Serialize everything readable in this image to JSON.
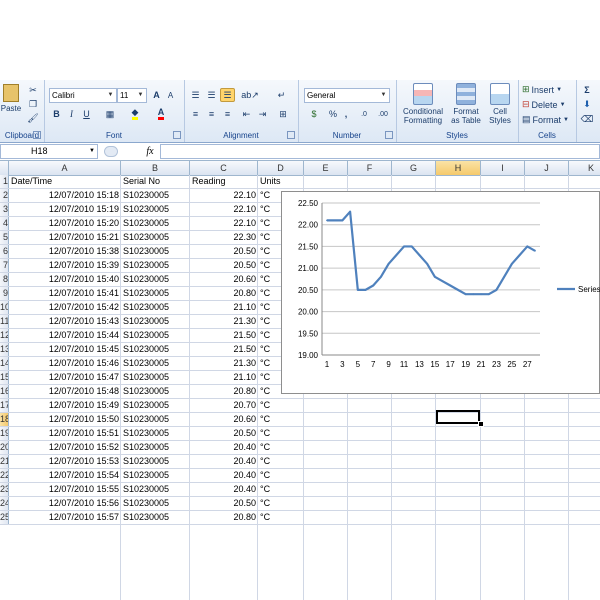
{
  "ribbon": {
    "clipboard": {
      "label": "Clipboard",
      "paste_label": "Paste"
    },
    "font": {
      "label": "Font",
      "name": "Calibri",
      "size": "11",
      "grow": "A",
      "shrink": "A",
      "bold": "B",
      "italic": "I",
      "underline": "U"
    },
    "alignment": {
      "label": "Alignment"
    },
    "number": {
      "label": "Number",
      "format": "General",
      "currency": "$",
      "percent": "%",
      "comma": ",",
      "inc_decimal": ".0",
      "dec_decimal": ".00"
    },
    "styles": {
      "label": "Styles",
      "conditional": [
        "Conditional",
        "Formatting"
      ],
      "format_table": [
        "Format",
        "as Table"
      ],
      "cell_styles": [
        "Cell",
        "Styles"
      ]
    },
    "cells": {
      "label": "Cells",
      "insert": "Insert",
      "delete": "Delete",
      "format": "Format"
    },
    "editing": {
      "sigma": "Σ"
    }
  },
  "formula_bar": {
    "name_box": "H18",
    "fx": "fx",
    "formula": ""
  },
  "columns": [
    "A",
    "B",
    "C",
    "D",
    "E",
    "F",
    "G",
    "H",
    "I",
    "J",
    "K"
  ],
  "active_column": "H",
  "active_row": "18",
  "sheet": {
    "header": {
      "row": "1",
      "date": "Date/Time",
      "serial": "Serial No",
      "reading": "Reading",
      "units": "Units"
    },
    "rows": [
      {
        "row": "2",
        "date": "12/07/2010 15:18",
        "serial": "S10230005",
        "reading": "22.10",
        "units": "°C"
      },
      {
        "row": "3",
        "date": "12/07/2010 15:19",
        "serial": "S10230005",
        "reading": "22.10",
        "units": "°C"
      },
      {
        "row": "4",
        "date": "12/07/2010 15:20",
        "serial": "S10230005",
        "reading": "22.10",
        "units": "°C"
      },
      {
        "row": "5",
        "date": "12/07/2010 15:21",
        "serial": "S10230005",
        "reading": "22.30",
        "units": "°C"
      },
      {
        "row": "6",
        "date": "12/07/2010 15:38",
        "serial": "S10230005",
        "reading": "20.50",
        "units": "°C"
      },
      {
        "row": "7",
        "date": "12/07/2010 15:39",
        "serial": "S10230005",
        "reading": "20.50",
        "units": "°C"
      },
      {
        "row": "8",
        "date": "12/07/2010 15:40",
        "serial": "S10230005",
        "reading": "20.60",
        "units": "°C"
      },
      {
        "row": "9",
        "date": "12/07/2010 15:41",
        "serial": "S10230005",
        "reading": "20.80",
        "units": "°C"
      },
      {
        "row": "10",
        "date": "12/07/2010 15:42",
        "serial": "S10230005",
        "reading": "21.10",
        "units": "°C"
      },
      {
        "row": "11",
        "date": "12/07/2010 15:43",
        "serial": "S10230005",
        "reading": "21.30",
        "units": "°C"
      },
      {
        "row": "12",
        "date": "12/07/2010 15:44",
        "serial": "S10230005",
        "reading": "21.50",
        "units": "°C"
      },
      {
        "row": "13",
        "date": "12/07/2010 15:45",
        "serial": "S10230005",
        "reading": "21.50",
        "units": "°C"
      },
      {
        "row": "14",
        "date": "12/07/2010 15:46",
        "serial": "S10230005",
        "reading": "21.30",
        "units": "°C"
      },
      {
        "row": "15",
        "date": "12/07/2010 15:47",
        "serial": "S10230005",
        "reading": "21.10",
        "units": "°C"
      },
      {
        "row": "16",
        "date": "12/07/2010 15:48",
        "serial": "S10230005",
        "reading": "20.80",
        "units": "°C"
      },
      {
        "row": "17",
        "date": "12/07/2010 15:49",
        "serial": "S10230005",
        "reading": "20.70",
        "units": "°C"
      },
      {
        "row": "18",
        "date": "12/07/2010 15:50",
        "serial": "S10230005",
        "reading": "20.60",
        "units": "°C"
      },
      {
        "row": "19",
        "date": "12/07/2010 15:51",
        "serial": "S10230005",
        "reading": "20.50",
        "units": "°C"
      },
      {
        "row": "20",
        "date": "12/07/2010 15:52",
        "serial": "S10230005",
        "reading": "20.40",
        "units": "°C"
      },
      {
        "row": "21",
        "date": "12/07/2010 15:53",
        "serial": "S10230005",
        "reading": "20.40",
        "units": "°C"
      },
      {
        "row": "22",
        "date": "12/07/2010 15:54",
        "serial": "S10230005",
        "reading": "20.40",
        "units": "°C"
      },
      {
        "row": "23",
        "date": "12/07/2010 15:55",
        "serial": "S10230005",
        "reading": "20.40",
        "units": "°C"
      },
      {
        "row": "24",
        "date": "12/07/2010 15:56",
        "serial": "S10230005",
        "reading": "20.50",
        "units": "°C"
      },
      {
        "row": "25",
        "date": "12/07/2010 15:57",
        "serial": "S10230005",
        "reading": "20.80",
        "units": "°C"
      }
    ]
  },
  "chart_data": {
    "type": "line",
    "title": "",
    "xlabel": "",
    "ylabel": "",
    "x": [
      1,
      2,
      3,
      4,
      5,
      6,
      7,
      8,
      9,
      10,
      11,
      12,
      13,
      14,
      15,
      16,
      17,
      18,
      19,
      20,
      21,
      22,
      23,
      24,
      25,
      26,
      27,
      28
    ],
    "x_tick_labels": [
      "1",
      "3",
      "5",
      "7",
      "9",
      "11",
      "13",
      "15",
      "17",
      "19",
      "21",
      "23",
      "25",
      "27"
    ],
    "y_tick_labels": [
      "19.00",
      "19.50",
      "20.00",
      "20.50",
      "21.00",
      "21.50",
      "22.00",
      "22.50"
    ],
    "ylim": [
      19.0,
      22.5
    ],
    "grid": true,
    "legend_position": "right",
    "series": [
      {
        "name": "Series",
        "color": "#4f81bd",
        "values": [
          22.1,
          22.1,
          22.1,
          22.3,
          20.5,
          20.5,
          20.6,
          20.8,
          21.1,
          21.3,
          21.5,
          21.5,
          21.3,
          21.1,
          20.8,
          20.7,
          20.6,
          20.5,
          20.4,
          20.4,
          20.4,
          20.4,
          20.5,
          20.8,
          21.1,
          21.3,
          21.5,
          21.4
        ]
      }
    ]
  }
}
